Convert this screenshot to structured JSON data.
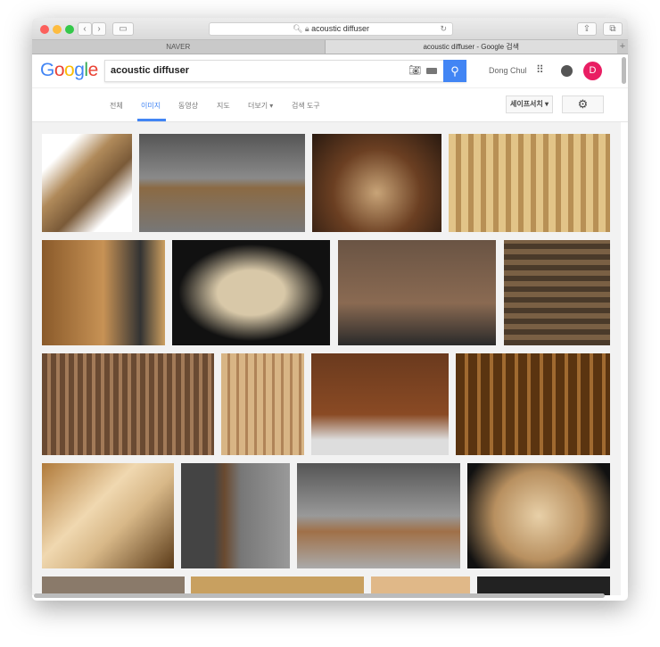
{
  "browser": {
    "url": "acoustic diffuser",
    "tabs": [
      {
        "label": "NAVER"
      },
      {
        "label": "acoustic diffuser - Google 검색"
      }
    ]
  },
  "header": {
    "logo": "Google",
    "query": "acoustic diffuser",
    "user": "Dong Chul",
    "avatar_letter": "D",
    "avatar_color": "#e91e63",
    "search_button_color": "#4285f4"
  },
  "nav": {
    "items": [
      "전체",
      "이미지",
      "동영상",
      "지도",
      "더보기 ▾",
      "검색 도구"
    ],
    "active": "이미지",
    "safesearch": "세이프서치 ▾"
  }
}
